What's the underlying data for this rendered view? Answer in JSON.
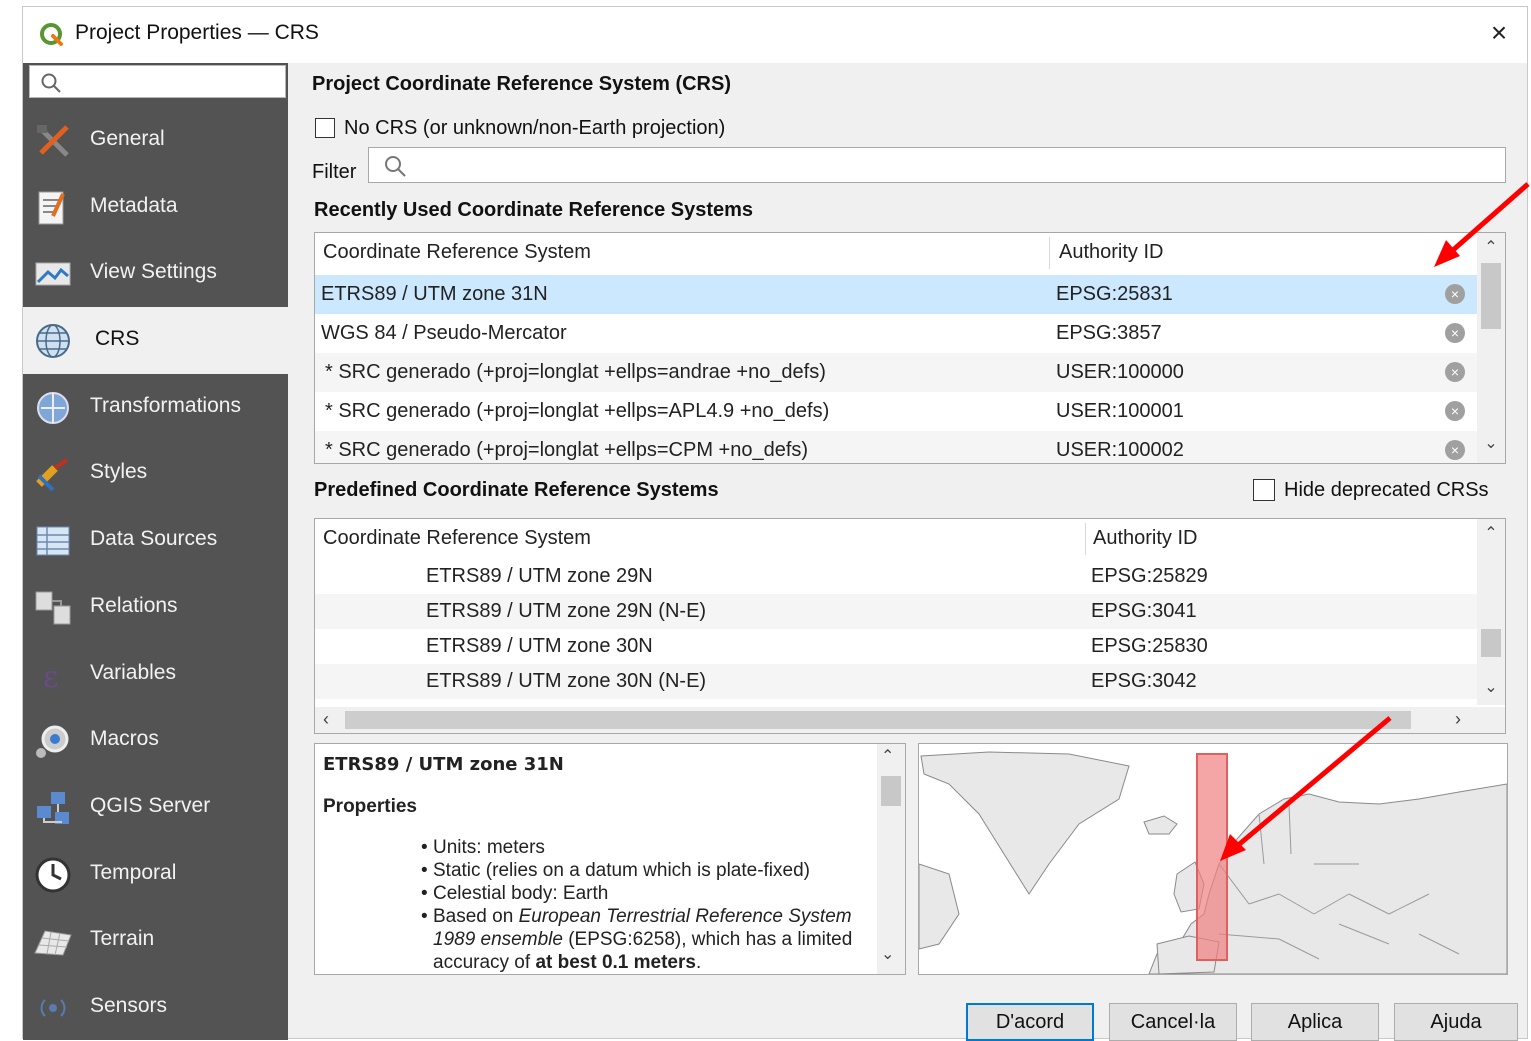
{
  "window": {
    "title": "Project Properties — CRS",
    "close_label": "×"
  },
  "sidebar": {
    "search_placeholder": "",
    "items": [
      {
        "label": "General",
        "icon": "tools-icon"
      },
      {
        "label": "Metadata",
        "icon": "metadata-icon"
      },
      {
        "label": "View Settings",
        "icon": "view-settings-icon"
      },
      {
        "label": "CRS",
        "icon": "globe-icon",
        "active": true
      },
      {
        "label": "Transformations",
        "icon": "transform-icon"
      },
      {
        "label": "Styles",
        "icon": "brush-icon"
      },
      {
        "label": "Data Sources",
        "icon": "data-sources-icon"
      },
      {
        "label": "Relations",
        "icon": "relations-icon"
      },
      {
        "label": "Variables",
        "icon": "variables-icon"
      },
      {
        "label": "Macros",
        "icon": "macros-icon"
      },
      {
        "label": "QGIS Server",
        "icon": "server-icon"
      },
      {
        "label": "Temporal",
        "icon": "clock-icon"
      },
      {
        "label": "Terrain",
        "icon": "terrain-icon"
      },
      {
        "label": "Sensors",
        "icon": "sensor-icon"
      }
    ]
  },
  "crs": {
    "section_title": "Project Coordinate Reference System (CRS)",
    "no_crs_label": "No CRS (or unknown/non-Earth projection)",
    "filter_label": "Filter",
    "filter_value": "",
    "recent_title": "Recently Used Coordinate Reference Systems",
    "recent_headers": {
      "crs": "Coordinate Reference System",
      "auth": "Authority ID"
    },
    "recent_rows": [
      {
        "crs": "ETRS89 / UTM zone 31N",
        "auth": "EPSG:25831"
      },
      {
        "crs": "WGS 84 / Pseudo-Mercator",
        "auth": "EPSG:3857"
      },
      {
        "crs": "* SRC generado (+proj=longlat +ellps=andrae +no_defs)",
        "auth": "USER:100000"
      },
      {
        "crs": "* SRC generado (+proj=longlat +ellps=APL4.9 +no_defs)",
        "auth": "USER:100001"
      },
      {
        "crs": "* SRC generado (+proj=longlat +ellps=CPM +no_defs)",
        "auth": "USER:100002"
      }
    ],
    "predefined_title": "Predefined Coordinate Reference Systems",
    "hide_deprecated_label": "Hide deprecated CRSs",
    "predefined_headers": {
      "crs": "Coordinate Reference System",
      "auth": "Authority ID"
    },
    "predefined_rows": [
      {
        "crs": "ETRS89 / UTM zone 29N",
        "auth": "EPSG:25829"
      },
      {
        "crs": "ETRS89 / UTM zone 29N (N-E)",
        "auth": "EPSG:3041"
      },
      {
        "crs": "ETRS89 / UTM zone 30N",
        "auth": "EPSG:25830"
      },
      {
        "crs": "ETRS89 / UTM zone 30N (N-E)",
        "auth": "EPSG:3042"
      }
    ],
    "info": {
      "name": "ETRS89 / UTM zone 31N",
      "properties_title": "Properties",
      "bullets": [
        "Units: meters",
        "Static (relies on a datum which is plate-fixed)",
        "Celestial body: Earth"
      ],
      "based_on_prefix": "Based on ",
      "based_on_italic": "European Terrestrial Reference System 1989 ensemble",
      "based_on_mid": " (EPSG:6258), which has a limited accuracy of ",
      "based_on_bold": "at best 0.1 meters",
      "based_on_end": "."
    }
  },
  "buttons": {
    "ok": "D'acord",
    "cancel": "Cancel·la",
    "apply": "Aplica",
    "help": "Ajuda"
  },
  "colors": {
    "sidebar_bg": "#535353",
    "selection": "#cce8ff",
    "annotation_arrow": "#ff0000",
    "map_highlight": "#f08080"
  }
}
